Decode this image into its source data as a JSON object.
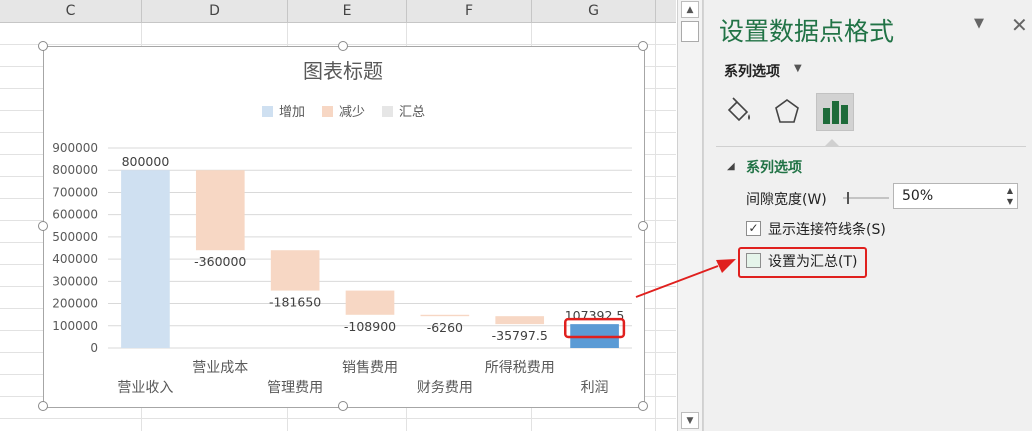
{
  "columns": [
    "C",
    "D",
    "E",
    "F",
    "G"
  ],
  "chart": {
    "title": "图表标题",
    "legend": [
      {
        "label": "增加",
        "color": "#cfe0f1"
      },
      {
        "label": "减少",
        "color": "#f7d7c4"
      },
      {
        "label": "汇总",
        "color": "#e6e6e6"
      }
    ],
    "y_ticks": [
      "900000",
      "800000",
      "700000",
      "600000",
      "500000",
      "400000",
      "300000",
      "200000",
      "100000",
      "0"
    ]
  },
  "chart_data": {
    "type": "bar",
    "subtype": "waterfall",
    "title": "图表标题",
    "ylim": [
      0,
      900000
    ],
    "grid": true,
    "legend_position": "top",
    "categories": [
      "营业收入",
      "营业成本",
      "管理费用",
      "销售费用",
      "财务费用",
      "所得税费用",
      "利润"
    ],
    "values": [
      800000,
      -360000,
      -181650,
      -108900,
      -6260,
      -35797.5,
      107392.5
    ],
    "value_labels": [
      "800000",
      "-360000",
      "-181650",
      "-108900",
      "-6260",
      "-35797.5",
      "107392.5"
    ],
    "series": [
      {
        "name": "增加",
        "color": "#cfe0f1"
      },
      {
        "name": "减少",
        "color": "#f7d7c4"
      },
      {
        "name": "汇总",
        "color": "#e6e6e6"
      }
    ],
    "selected_point_color": "#5b9bd5"
  },
  "panel": {
    "title": "设置数据点格式",
    "series_options_dropdown": "系列选项",
    "section_label": "系列选项",
    "gap_width_label": "间隙宽度(W)",
    "gap_width_value": "50%",
    "show_connector_label": "显示连接符线条(S)",
    "set_as_total_label": "设置为汇总(T)"
  }
}
